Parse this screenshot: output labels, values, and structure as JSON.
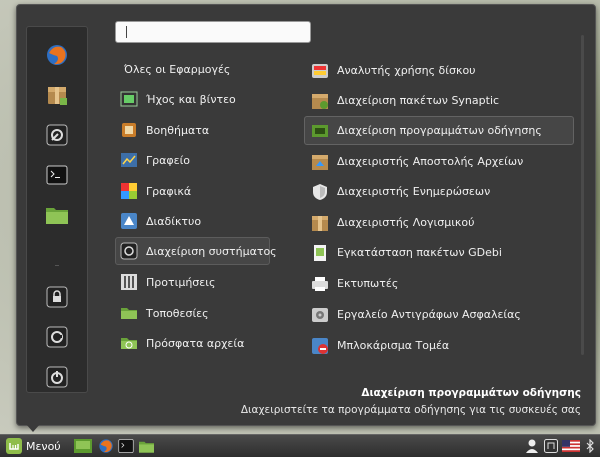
{
  "search": {
    "value": ""
  },
  "categories": [
    {
      "label": "Όλες οι Εφαρμογές",
      "icon": "none"
    },
    {
      "label": "Ήχος και βίντεο",
      "icon": "multimedia-icon"
    },
    {
      "label": "Βοηθήματα",
      "icon": "accessories-icon"
    },
    {
      "label": "Γραφείο",
      "icon": "office-icon"
    },
    {
      "label": "Γραφικά",
      "icon": "graphics-icon"
    },
    {
      "label": "Διαδίκτυο",
      "icon": "internet-icon"
    },
    {
      "label": "Διαχείριση συστήματος",
      "icon": "system-admin-icon"
    },
    {
      "label": "Προτιμήσεις",
      "icon": "preferences-icon"
    },
    {
      "label": "Τοποθεσίες",
      "icon": "places-icon"
    },
    {
      "label": "Πρόσφατα αρχεία",
      "icon": "recent-files-icon"
    }
  ],
  "apps": [
    {
      "label": "Αναλυτής χρήσης δίσκου",
      "icon": "disk-usage-icon"
    },
    {
      "label": "Διαχείριση πακέτων Synaptic",
      "icon": "synaptic-icon"
    },
    {
      "label": "Διαχείριση προγραμμάτων οδήγησης",
      "icon": "driver-manager-icon"
    },
    {
      "label": "Διαχειριστής Αποστολής Αρχείων",
      "icon": "upload-manager-icon"
    },
    {
      "label": "Διαχειριστής Ενημερώσεων",
      "icon": "update-manager-icon"
    },
    {
      "label": "Διαχειριστής Λογισμικού",
      "icon": "software-manager-icon"
    },
    {
      "label": "Εγκατάσταση πακέτων GDebi",
      "icon": "gdebi-icon"
    },
    {
      "label": "Εκτυπωτές",
      "icon": "printer-icon"
    },
    {
      "label": "Εργαλείο Αντιγράφων Ασφαλείας",
      "icon": "backup-tool-icon"
    },
    {
      "label": "Μπλοκάρισμα Τομέα",
      "icon": "domain-blocker-icon"
    }
  ],
  "description": {
    "title": "Διαχείριση προγραμμάτων οδήγησης",
    "body": "Διαχειριστείτε τα προγράμματα οδήγησης για τις συσκευές σας"
  },
  "taskbar": {
    "menu_label": "Μενού"
  },
  "colors": {
    "accent_green": "#8fbd4a",
    "panel": "#3a3a3a"
  }
}
